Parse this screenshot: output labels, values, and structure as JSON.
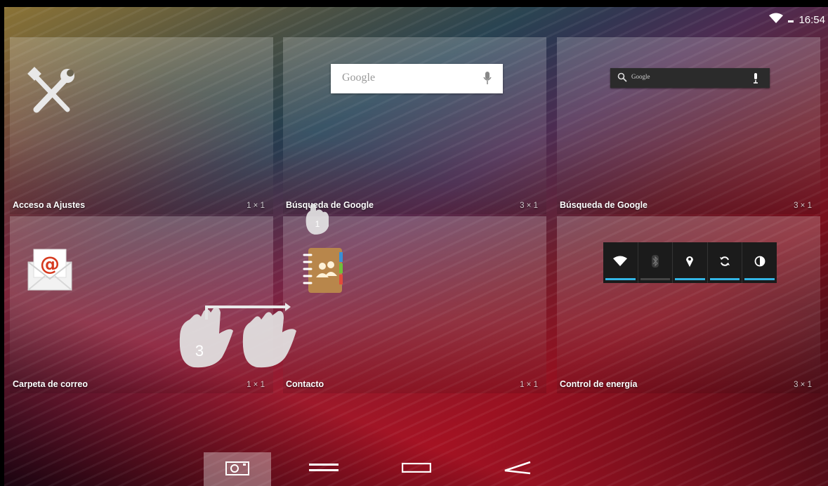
{
  "status_bar": {
    "time": "16:54",
    "icons": [
      "wifi-icon",
      "battery-icon"
    ]
  },
  "widgets": [
    {
      "label": "Acceso a Ajustes",
      "size": "1 × 1",
      "icon": "settings-tools-icon"
    },
    {
      "label": "Búsqueda de Google",
      "size": "3 × 1",
      "icon": "google-search-bar-light",
      "search_placeholder": "Google"
    },
    {
      "label": "Búsqueda de Google",
      "size": "3 × 1",
      "icon": "google-search-bar-dark",
      "search_placeholder": "Google"
    },
    {
      "label": "Carpeta de correo",
      "size": "1 × 1",
      "icon": "email-icon"
    },
    {
      "label": "Contacto",
      "size": "1 × 1",
      "icon": "contacts-book-icon"
    },
    {
      "label": "Control de energía",
      "size": "3 × 1",
      "icon": "power-control-widget",
      "toggles": [
        {
          "name": "wifi",
          "on": true
        },
        {
          "name": "bluetooth",
          "on": false
        },
        {
          "name": "location",
          "on": true
        },
        {
          "name": "sync",
          "on": true
        },
        {
          "name": "brightness",
          "on": true
        }
      ]
    }
  ],
  "nav_bar": {
    "buttons": [
      "screenshot-icon",
      "menu-icon",
      "recent-apps-icon",
      "back-icon"
    ]
  },
  "gesture_overlay": {
    "fingers_label": "3",
    "touch_label": "1"
  },
  "colors": {
    "accent": "#33b5e5",
    "tile_overlay": "rgba(255,255,255,0.2)",
    "bar_off": "#444444"
  }
}
